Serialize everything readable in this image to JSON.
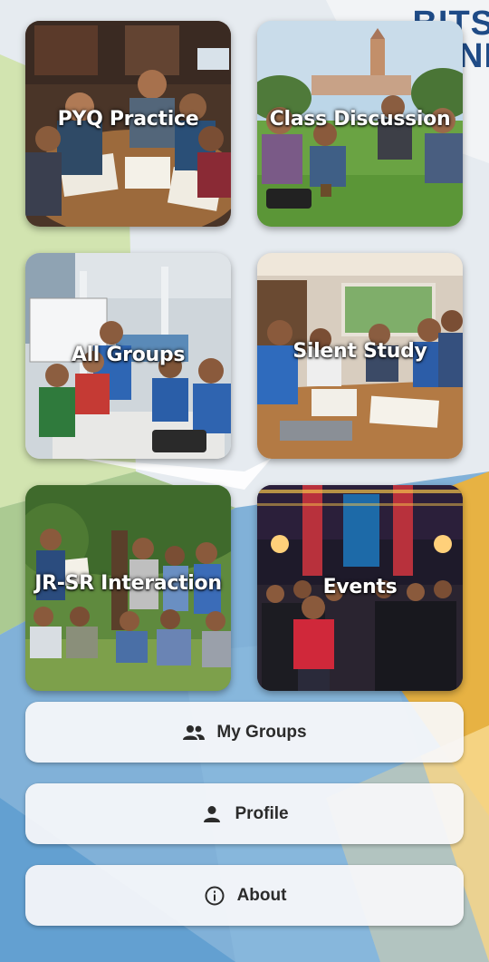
{
  "logo": {
    "line1": "BITS",
    "line2": "NI"
  },
  "tiles": [
    {
      "label": "PYQ Practice",
      "icon": "study-table-photo"
    },
    {
      "label": "Class Discussion",
      "icon": "lawn-discussion-photo"
    },
    {
      "label": "All Groups",
      "icon": "library-groups-photo"
    },
    {
      "label": "Silent Study",
      "icon": "reading-room-photo"
    },
    {
      "label": "JR-SR Interaction",
      "icon": "outdoor-interaction-photo"
    },
    {
      "label": "Events",
      "icon": "fest-crowd-photo"
    }
  ],
  "buttons": {
    "my_groups": {
      "label": "My Groups",
      "icon": "group-icon"
    },
    "profile": {
      "label": "Profile",
      "icon": "person-icon"
    },
    "about": {
      "label": "About",
      "icon": "info-icon"
    }
  },
  "colors": {
    "accent_blue": "#1f4b86",
    "button_bg": "#f8f8fa"
  }
}
